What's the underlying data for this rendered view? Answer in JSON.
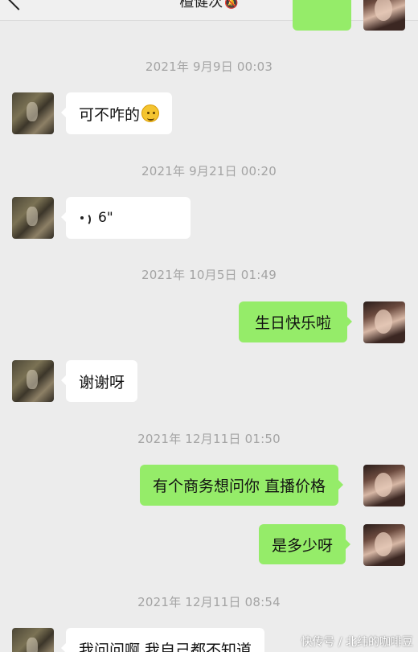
{
  "header": {
    "title": "檀健次",
    "mute_icon": "bell-off-icon",
    "back_icon": "back-arrow-icon"
  },
  "messages": [
    {
      "type": "timestamp",
      "text": "2021年 9月9日 00:03"
    },
    {
      "type": "text",
      "side": "left",
      "text": "可不咋的",
      "emoji": "thinking-face"
    },
    {
      "type": "timestamp",
      "text": "2021年 9月21日 00:20"
    },
    {
      "type": "voice",
      "side": "left",
      "duration": "6\""
    },
    {
      "type": "timestamp",
      "text": "2021年 10月5日 01:49"
    },
    {
      "type": "text",
      "side": "right",
      "text": "生日快乐啦"
    },
    {
      "type": "text",
      "side": "left",
      "text": "谢谢呀"
    },
    {
      "type": "timestamp",
      "text": "2021年 12月11日 01:50"
    },
    {
      "type": "text",
      "side": "right",
      "text": "有个商务想问你 直播价格"
    },
    {
      "type": "text",
      "side": "right",
      "text": "是多少呀"
    },
    {
      "type": "timestamp",
      "text": "2021年 12月11日 08:54"
    },
    {
      "type": "text",
      "side": "left",
      "text": "我问问啊 我自己都不知道"
    }
  ],
  "watermark": "快传号 / 北纬的咖啡豆",
  "colors": {
    "background": "#ececec",
    "self_bubble": "#95ec69",
    "other_bubble": "#ffffff",
    "timestamp": "#a4a4a4"
  }
}
